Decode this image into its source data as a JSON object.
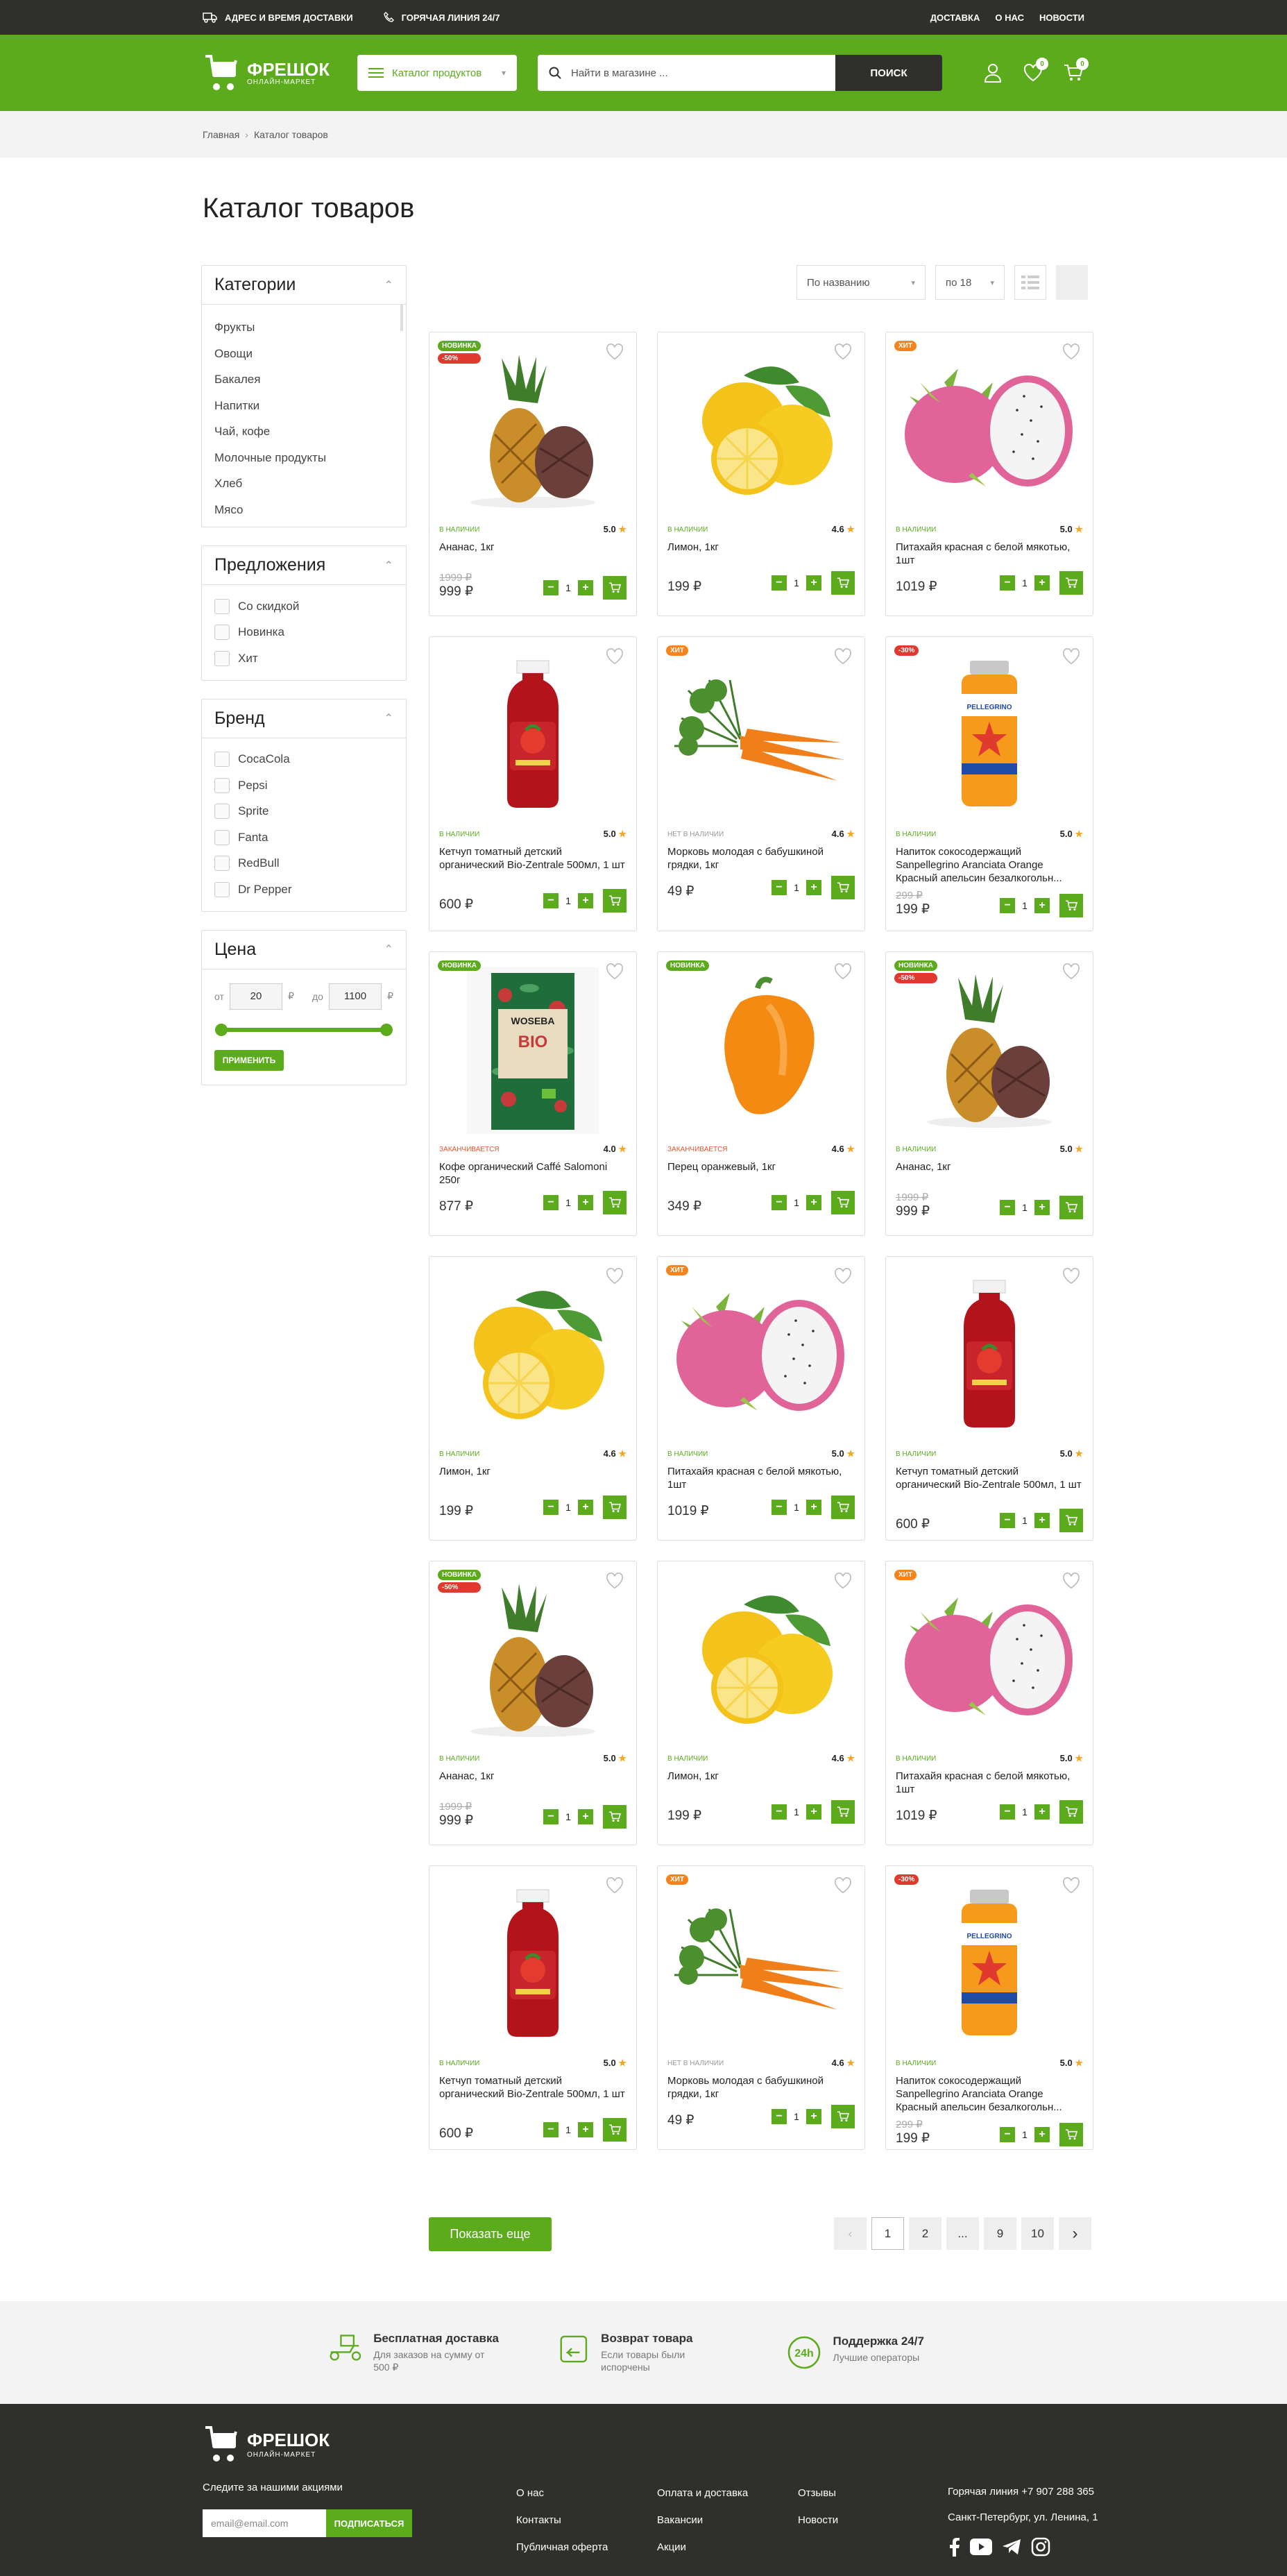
{
  "topbar": {
    "delivery": "АДРЕС И ВРЕМЯ ДОСТАВКИ",
    "hotline": "ГОРЯЧАЯ ЛИНИЯ 24/7",
    "links": [
      "ДОСТАВКА",
      "О НАС",
      "НОВОСТИ"
    ]
  },
  "header": {
    "logo_name": "ФРЕШОК",
    "logo_sub": "ОНЛАЙН-МАРКЕТ",
    "catalog": "Каталог продуктов",
    "search_placeholder": "Найти в магазине ...",
    "search_btn": "ПОИСК",
    "fav_count": "0",
    "cart_count": "0"
  },
  "breadcrumb": {
    "home": "Главная",
    "current": "Каталог товаров"
  },
  "page_title": "Каталог товаров",
  "filters": {
    "categories_title": "Категории",
    "categories": [
      "Фрукты",
      "Овощи",
      "Бакалея",
      "Напитки",
      "Чай, кофе",
      "Молочные продукты",
      "Хлеб",
      "Мясо"
    ],
    "offers_title": "Предложения",
    "offers": [
      "Со скидкой",
      "Новинка",
      "Хит"
    ],
    "brand_title": "Бренд",
    "brands": [
      "CocaCola",
      "Pepsi",
      "Sprite",
      "Fanta",
      "RedBull",
      "Dr Pepper"
    ],
    "price_title": "Цена",
    "from": "от",
    "to": "до",
    "min": "20",
    "max": "1100",
    "cur": "₽",
    "apply": "ПРИМЕНИТЬ"
  },
  "sort": {
    "by": "По названию",
    "per_page": "по 18"
  },
  "products": [
    {
      "img": "pineapple",
      "tags": [
        {
          "t": "НОВИНКА",
          "c": "#5bab1c"
        },
        {
          "t": "-50%",
          "c": "#e03a2f"
        }
      ],
      "avail": "В НАЛИЧИИ",
      "a": "ok",
      "rating": "5.0",
      "name": "Ананас, 1кг",
      "old": "1999 ₽",
      "price": "999 ₽"
    },
    {
      "img": "lemon",
      "tags": [],
      "avail": "В НАЛИЧИИ",
      "a": "ok",
      "rating": "4.6",
      "name": "Лимон, 1кг",
      "old": "",
      "price": "199 ₽"
    },
    {
      "img": "pitaya",
      "tags": [
        {
          "t": "ХИТ",
          "c": "#f5841f"
        }
      ],
      "avail": "В НАЛИЧИИ",
      "a": "ok",
      "rating": "5.0",
      "name": "Питахайя красная с белой мякотью, 1шт",
      "old": "",
      "price": "1019 ₽"
    },
    {
      "img": "ketchup",
      "tags": [],
      "avail": "В НАЛИЧИИ",
      "a": "ok",
      "rating": "5.0",
      "name": "Кетчуп томатный детский органический Bio-Zentrale 500мл, 1 шт",
      "old": "",
      "price": "600 ₽"
    },
    {
      "img": "carrot",
      "tags": [
        {
          "t": "ХИТ",
          "c": "#f5841f"
        }
      ],
      "avail": "НЕТ В НАЛИЧИИ",
      "a": "na",
      "rating": "4.6",
      "name": "Морковь молодая с бабушкиной грядки, 1кг",
      "old": "",
      "price": "49 ₽"
    },
    {
      "img": "drink",
      "tags": [
        {
          "t": "-30%",
          "c": "#e03a2f"
        }
      ],
      "avail": "В НАЛИЧИИ",
      "a": "ok",
      "rating": "5.0",
      "name": "Напиток сокосодержащий Sanpellegrino Aranciata Orange Красный апельсин безалкогольн...",
      "old": "299 ₽",
      "price": "199 ₽"
    },
    {
      "img": "coffee",
      "tags": [
        {
          "t": "НОВИНКА",
          "c": "#5bab1c"
        }
      ],
      "avail": "ЗАКАНЧИВАЕТСЯ",
      "a": "end",
      "rating": "4.0",
      "name": "Кофе органический Caffé Salomoni 250г",
      "old": "",
      "price": "877 ₽"
    },
    {
      "img": "pepper",
      "tags": [
        {
          "t": "НОВИНКА",
          "c": "#5bab1c"
        }
      ],
      "avail": "ЗАКАНЧИВАЕТСЯ",
      "a": "end",
      "rating": "4.6",
      "name": "Перец оранжевый, 1кг",
      "old": "",
      "price": "349 ₽"
    },
    {
      "img": "pineapple",
      "tags": [
        {
          "t": "НОВИНКА",
          "c": "#5bab1c"
        },
        {
          "t": "-50%",
          "c": "#e03a2f"
        }
      ],
      "avail": "В НАЛИЧИИ",
      "a": "ok",
      "rating": "5.0",
      "name": "Ананас, 1кг",
      "old": "1999 ₽",
      "price": "999 ₽"
    },
    {
      "img": "lemon",
      "tags": [],
      "avail": "В НАЛИЧИИ",
      "a": "ok",
      "rating": "4.6",
      "name": "Лимон, 1кг",
      "old": "",
      "price": "199 ₽"
    },
    {
      "img": "pitaya",
      "tags": [
        {
          "t": "ХИТ",
          "c": "#f5841f"
        }
      ],
      "avail": "В НАЛИЧИИ",
      "a": "ok",
      "rating": "5.0",
      "name": "Питахайя красная с белой мякотью, 1шт",
      "old": "",
      "price": "1019 ₽"
    },
    {
      "img": "ketchup",
      "tags": [],
      "avail": "В НАЛИЧИИ",
      "a": "ok",
      "rating": "5.0",
      "name": "Кетчуп томатный детский органический Bio-Zentrale 500мл, 1 шт",
      "old": "",
      "price": "600 ₽"
    },
    {
      "img": "pineapple",
      "tags": [
        {
          "t": "НОВИНКА",
          "c": "#5bab1c"
        },
        {
          "t": "-50%",
          "c": "#e03a2f"
        }
      ],
      "avail": "В НАЛИЧИИ",
      "a": "ok",
      "rating": "5.0",
      "name": "Ананас, 1кг",
      "old": "1999 ₽",
      "price": "999 ₽"
    },
    {
      "img": "lemon",
      "tags": [],
      "avail": "В НАЛИЧИИ",
      "a": "ok",
      "rating": "4.6",
      "name": "Лимон, 1кг",
      "old": "",
      "price": "199 ₽"
    },
    {
      "img": "pitaya",
      "tags": [
        {
          "t": "ХИТ",
          "c": "#f5841f"
        }
      ],
      "avail": "В НАЛИЧИИ",
      "a": "ok",
      "rating": "5.0",
      "name": "Питахайя красная с белой мякотью, 1шт",
      "old": "",
      "price": "1019 ₽"
    },
    {
      "img": "ketchup",
      "tags": [],
      "avail": "В НАЛИЧИИ",
      "a": "ok",
      "rating": "5.0",
      "name": "Кетчуп томатный детский органический Bio-Zentrale 500мл, 1 шт",
      "old": "",
      "price": "600 ₽"
    },
    {
      "img": "carrot",
      "tags": [
        {
          "t": "ХИТ",
          "c": "#f5841f"
        }
      ],
      "avail": "НЕТ В НАЛИЧИИ",
      "a": "na",
      "rating": "4.6",
      "name": "Морковь молодая с бабушкиной грядки, 1кг",
      "old": "",
      "price": "49 ₽"
    },
    {
      "img": "drink",
      "tags": [
        {
          "t": "-30%",
          "c": "#e03a2f"
        }
      ],
      "avail": "В НАЛИЧИИ",
      "a": "ok",
      "rating": "5.0",
      "name": "Напиток сокосодержащий Sanpellegrino Aranciata Orange Красный апельсин безалкогольн...",
      "old": "299 ₽",
      "price": "199 ₽"
    }
  ],
  "qty": "1",
  "show_more": "Показать еще",
  "pagination": [
    "1",
    "2",
    "...",
    "9",
    "10"
  ],
  "features": [
    {
      "title": "Бесплатная доставка",
      "desc": "Для заказов на сумму от 500 ₽"
    },
    {
      "title": "Возврат товара",
      "desc": "Если товары были испорчены"
    },
    {
      "title": "Поддержка 24/7",
      "desc": "Лучшие операторы"
    }
  ],
  "footer": {
    "subscribe": "Следите за нашими акциями",
    "email_placeholder": "email@email.com",
    "subscribe_btn": "ПОДПИСАТЬСЯ",
    "col1": [
      "О нас",
      "Контакты",
      "Публичная оферта"
    ],
    "col2": [
      "Оплата и доставка",
      "Вакансии",
      "Акции"
    ],
    "col3": [
      "Отзывы",
      "Новости"
    ],
    "hotline": "Горячая линия +7 907 288 365",
    "address": "Санкт-Петербург, ул. Ленина, 1"
  },
  "colors": {
    "brand": "#5bab1c",
    "dark": "#2f2f2b"
  }
}
